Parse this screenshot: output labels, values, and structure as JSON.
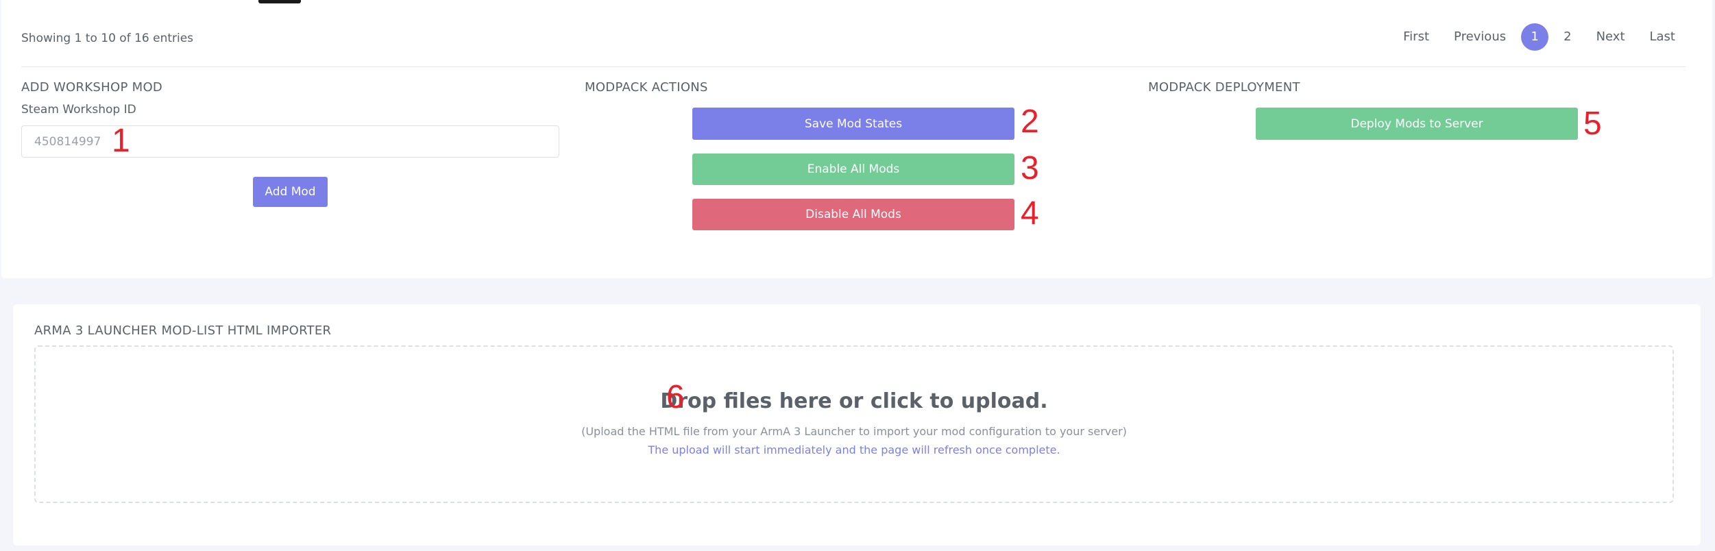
{
  "table": {
    "entries_info": "Showing 1 to 10 of 16 entries",
    "pagination": {
      "first": "First",
      "previous": "Previous",
      "pages": [
        "1",
        "2"
      ],
      "current": "1",
      "next": "Next",
      "last": "Last"
    }
  },
  "add_mod": {
    "title": "ADD WORKSHOP MOD",
    "field_label": "Steam Workshop ID",
    "placeholder": "450814997",
    "button": "Add Mod"
  },
  "actions": {
    "title": "MODPACK ACTIONS",
    "save": "Save Mod States",
    "enable_all": "Enable All Mods",
    "disable_all": "Disable All Mods"
  },
  "deployment": {
    "title": "MODPACK DEPLOYMENT",
    "deploy": "Deploy Mods to Server"
  },
  "importer": {
    "title": "ARMA 3 LAUNCHER MOD-LIST HTML IMPORTER",
    "drop_text": "Drop files here or click to upload.",
    "hint": "(Upload the HTML file from your ArmA 3 Launcher to import your mod configuration to your server)",
    "note": "The upload will start immediately and the page will refresh once complete."
  },
  "annotations": [
    "1",
    "2",
    "3",
    "4",
    "5",
    "6"
  ],
  "colors": {
    "primary": "#7b7fe8",
    "success": "#73cc96",
    "danger": "#e0687b",
    "annotation": "#e8202a"
  }
}
